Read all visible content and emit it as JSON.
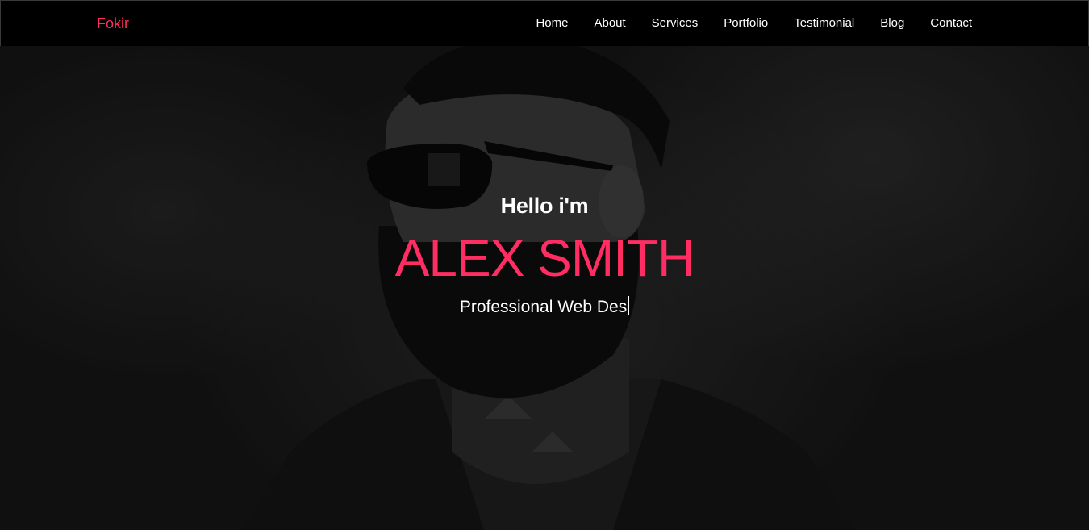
{
  "brand": {
    "name": "Fokir",
    "color": "#ff2d62"
  },
  "nav": {
    "items": [
      {
        "label": "Home"
      },
      {
        "label": "About"
      },
      {
        "label": "Services"
      },
      {
        "label": "Portfolio"
      },
      {
        "label": "Testimonial"
      },
      {
        "label": "Blog"
      },
      {
        "label": "Contact"
      }
    ]
  },
  "hero": {
    "greeting": "Hello i'm",
    "name": "ALEX SMITH",
    "role_typed": "Professional Web Des",
    "accent_color": "#ff2d62",
    "background_image": "bearded man with sunglasses and neck tattoos"
  }
}
